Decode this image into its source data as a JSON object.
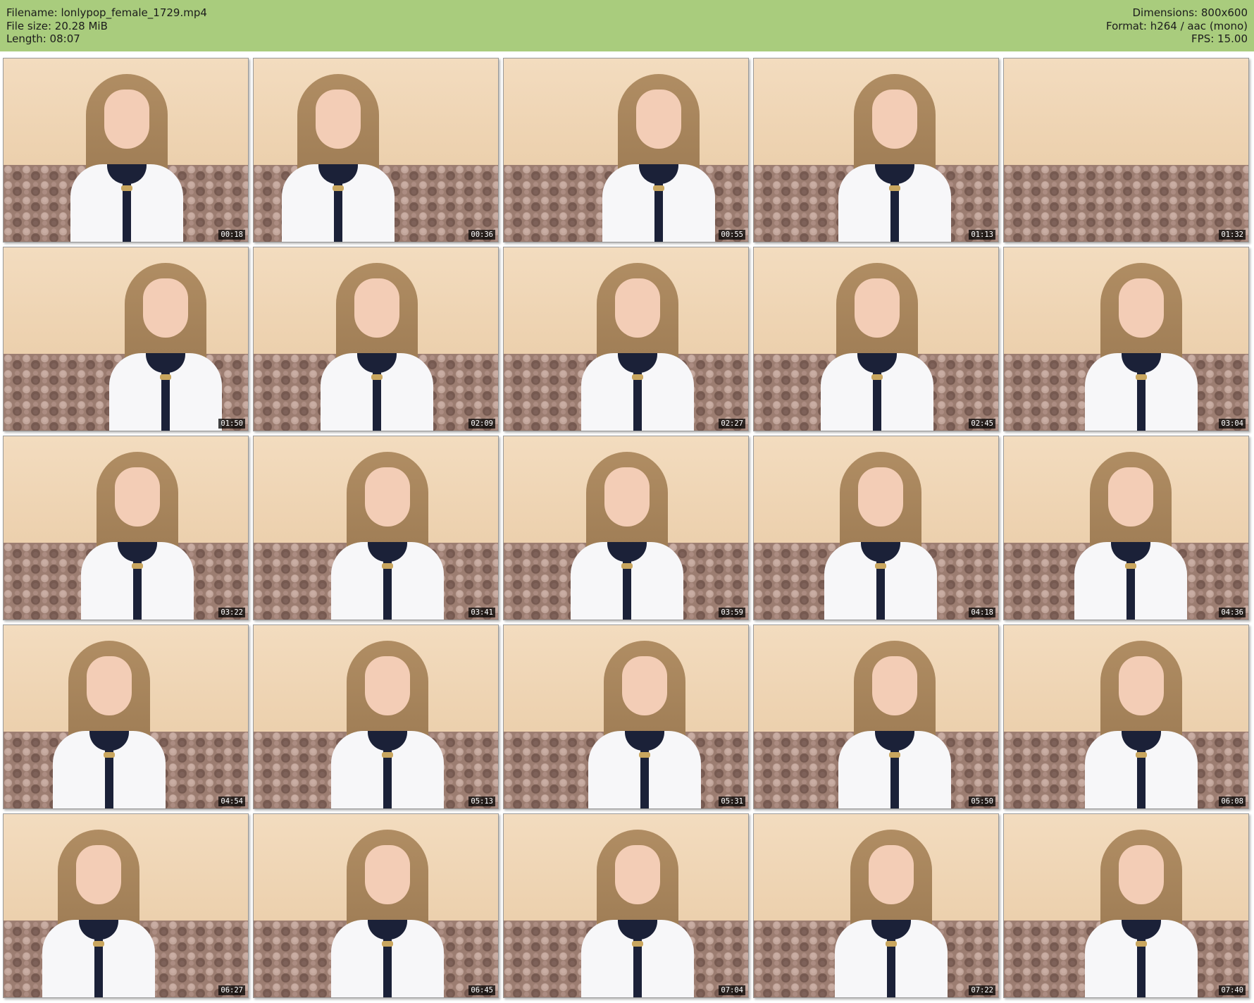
{
  "header": {
    "filename": "Filename: lonlypop_female_1729.mp4",
    "file_size": "File size: 20.28 MiB",
    "length": "Length: 08:07",
    "dimensions": "Dimensions: 800x600",
    "format": "Format: h264 / aac (mono)",
    "fps": "FPS: 15.00"
  },
  "colors": {
    "header_bg": "#a9cc7d",
    "wall": "#eccfae",
    "shirt": "#f7f7f9",
    "collar": "#1b2138"
  },
  "thumbnails": [
    {
      "timestamp": "00:18"
    },
    {
      "timestamp": "00:36"
    },
    {
      "timestamp": "00:55"
    },
    {
      "timestamp": "01:13"
    },
    {
      "timestamp": "01:32"
    },
    {
      "timestamp": "01:50"
    },
    {
      "timestamp": "02:09"
    },
    {
      "timestamp": "02:27"
    },
    {
      "timestamp": "02:45"
    },
    {
      "timestamp": "03:04"
    },
    {
      "timestamp": "03:22"
    },
    {
      "timestamp": "03:41"
    },
    {
      "timestamp": "03:59"
    },
    {
      "timestamp": "04:18"
    },
    {
      "timestamp": "04:36"
    },
    {
      "timestamp": "04:54"
    },
    {
      "timestamp": "05:13"
    },
    {
      "timestamp": "05:31"
    },
    {
      "timestamp": "05:50"
    },
    {
      "timestamp": "06:08"
    },
    {
      "timestamp": "06:27"
    },
    {
      "timestamp": "06:45"
    },
    {
      "timestamp": "07:04"
    },
    {
      "timestamp": "07:22"
    },
    {
      "timestamp": "07:40"
    }
  ]
}
